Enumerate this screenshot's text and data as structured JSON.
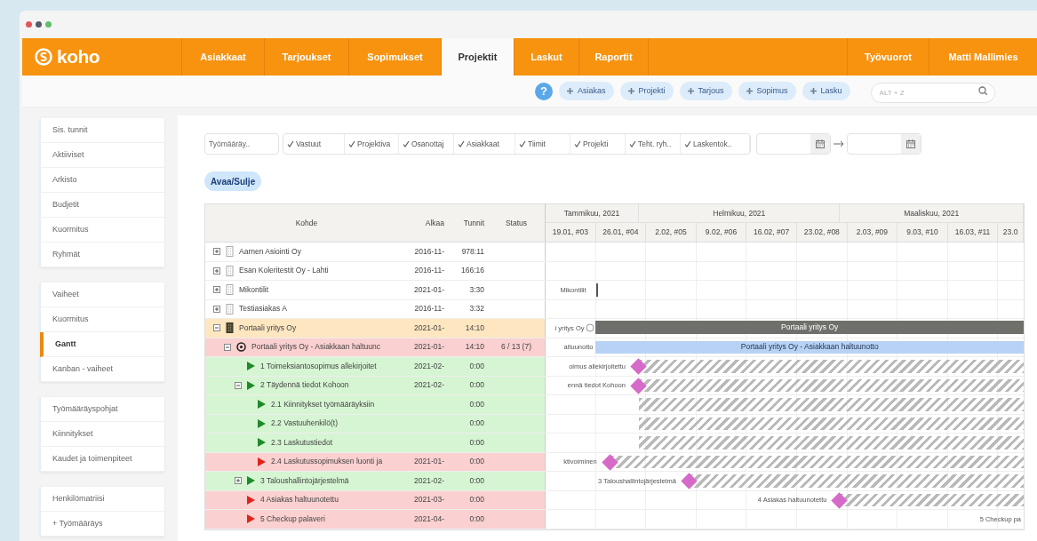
{
  "brand": "koho",
  "nav": [
    {
      "label": "Asiakkaat",
      "selected": false
    },
    {
      "label": "Tarjoukset",
      "selected": false
    },
    {
      "label": "Sopimukset",
      "selected": false
    },
    {
      "label": "Projektit",
      "selected": true
    },
    {
      "label": "Laskut",
      "selected": false
    },
    {
      "label": "Raportit",
      "selected": false
    }
  ],
  "nav_right": [
    "Työvuorot",
    "Matti Mallimies"
  ],
  "help": "?",
  "quick_add": [
    "Asiakas",
    "Projekti",
    "Tarjous",
    "Sopimus",
    "Lasku"
  ],
  "search": {
    "placeholder": "ALT + Z"
  },
  "sidebar": [
    {
      "items": [
        {
          "label": "Sis. tunnit",
          "selected": false
        },
        {
          "label": "Aktiiviset",
          "selected": false
        },
        {
          "label": "Arkisto",
          "selected": false
        },
        {
          "label": "Budjetit",
          "selected": false
        },
        {
          "label": "Kuormitus",
          "selected": false
        },
        {
          "label": "Ryhmät",
          "selected": false
        }
      ]
    },
    {
      "items": [
        {
          "label": "Vaiheet",
          "selected": false
        },
        {
          "label": "Kuormitus",
          "selected": false
        },
        {
          "label": "Gantt",
          "selected": true
        },
        {
          "label": "Kanban - vaiheet",
          "selected": false
        }
      ]
    },
    {
      "items": [
        {
          "label": "Työmääräyspohjat",
          "selected": false
        },
        {
          "label": "Kiinnitykset",
          "selected": false
        },
        {
          "label": "Kaudet ja toimenpiteet",
          "selected": false
        }
      ]
    },
    {
      "items": [
        {
          "label": "Henkilömatriisi",
          "selected": false
        },
        {
          "label": "+ Työmääräys",
          "selected": false
        }
      ]
    }
  ],
  "filters": {
    "dropdown": "Työmääräy..",
    "toggles": [
      {
        "label": "Vastuut",
        "checked": true
      },
      {
        "label": "Projektiva",
        "checked": true
      },
      {
        "label": "Osanottaj",
        "checked": true
      },
      {
        "label": "Asiakkaat",
        "checked": true
      },
      {
        "label": "Tiimit",
        "checked": true
      },
      {
        "label": "Projekti",
        "checked": true
      },
      {
        "label": "Teht. ryh..",
        "checked": true
      },
      {
        "label": "Laskentok..",
        "checked": true
      }
    ]
  },
  "toggle_button": "Avaa/Sulje",
  "table": {
    "columns": [
      "Kohde",
      "Alkaa",
      "Tunnit",
      "Status"
    ],
    "months": [
      "Tammikuu, 2021",
      "Helmikuu, 2021",
      "Maaliskuu, 2021"
    ],
    "weeks": [
      "19.01, #03",
      "26.01, #04",
      "2.02, #05",
      "9.02, #06",
      "16.02, #07",
      "23.02, #08",
      "2.03, #09",
      "9.03, #10",
      "16.03, #11",
      "23.0"
    ],
    "rows": [
      {
        "kind": "customer",
        "expanded": false,
        "color": "#ffffff",
        "name": "Aarnen Asiointi Oy",
        "start": "2016-11-",
        "hours": "978:11"
      },
      {
        "kind": "customer",
        "expanded": false,
        "color": "#ffffff",
        "name": "Esan Koleritestit Oy - Lahti",
        "start": "2016-11-",
        "hours": "166:16"
      },
      {
        "kind": "customer",
        "expanded": false,
        "color": "#ffffff",
        "name": "Mikontilit",
        "start": "2021-01-",
        "hours": "3:30",
        "gantt": {
          "label": "Mikontilit",
          "kind": "marker"
        }
      },
      {
        "kind": "customer",
        "expanded": false,
        "color": "#ffffff",
        "name": "Testiasiakas A",
        "start": "2016-11-",
        "hours": "3:32"
      },
      {
        "kind": "customer",
        "expanded": true,
        "color": "#fde6c0",
        "name": "Portaali yritys Oy",
        "start": "2021-01-",
        "hours": "14:10",
        "gantt": {
          "label": "i yritys Oy",
          "kind": "summary",
          "level": 0.895,
          "text": "Portaali yritys Oy"
        },
        "children": [
          {
            "kind": "project",
            "expanded": true,
            "color": "#fbd0d0",
            "name": "Portaali yritys Oy - Asiakkaan haltuunc",
            "start": "2021-01-",
            "hours": "14:10",
            "status": "6 / 13 (7)",
            "gantt": {
              "label": "altuunotto",
              "kind": "task",
              "level": 0.895,
              "text": "Portaali yritys Oy - Asiakkaan haltuunotto"
            },
            "children": [
              {
                "kind": "task",
                "late": false,
                "color": "#d6f5d3",
                "name": "1 Toimeksiantosopimus allekirjoitet",
                "start": "2021-02-",
                "hours": "0:00",
                "gantt": {
                  "label": "oimus allekirjoitettu",
                  "kind": "milestone",
                  "level": 0.805
                }
              },
              {
                "kind": "task",
                "late": false,
                "expanded": true,
                "color": "#d6f5d3",
                "name": "2 Täydennä tiedot Kohoon",
                "start": "2021-02-",
                "hours": "0:00",
                "gantt": {
                  "label": "ennä tiedot Kohoon",
                  "kind": "milestone",
                  "level": 0.805
                },
                "children": [
                  {
                    "kind": "task",
                    "late": false,
                    "color": "#d6f5d3",
                    "name": "2.1 Kiinnitykset työmääräyksiin",
                    "hours": "0:00",
                    "gantt": {
                      "kind": "hatch",
                      "level": 0.805
                    }
                  },
                  {
                    "kind": "task",
                    "late": false,
                    "color": "#d6f5d3",
                    "name": "2.2 Vastuuhenkilö(t)",
                    "hours": "0:00",
                    "gantt": {
                      "kind": "hatch",
                      "level": 0.805
                    }
                  },
                  {
                    "kind": "task",
                    "late": false,
                    "color": "#d6f5d3",
                    "name": "2.3 Laskutustiedot",
                    "hours": "0:00",
                    "gantt": {
                      "kind": "hatch",
                      "level": 0.805
                    }
                  },
                  {
                    "kind": "task",
                    "late": true,
                    "color": "#fbd0d0",
                    "name": "2.4 Laskutussopimuksen luonti ja",
                    "start": "2021-01-",
                    "hours": "0:00",
                    "gantt": {
                      "label": "ktivoiminen",
                      "kind": "milestone",
                      "level": 0.865
                    }
                  }
                ]
              },
              {
                "kind": "task",
                "late": false,
                "expanded": false,
                "color": "#d6f5d3",
                "name": "3 Taloushallintojärjestelmä",
                "start": "2021-02-",
                "hours": "0:00",
                "gantt": {
                  "label": "3 Taloushallintojärjestelmä",
                  "kind": "milestone",
                  "level": 0.699
                }
              },
              {
                "kind": "task",
                "late": true,
                "color": "#fbd0d0",
                "name": "4 Asiakas haltuunotettu",
                "start": "2021-03-",
                "hours": "0:00",
                "gantt": {
                  "label": "4 Asiakas haltuunotettu",
                  "kind": "milestone",
                  "level": 0.384
                }
              },
              {
                "kind": "task",
                "late": true,
                "color": "#fbd0d0",
                "name": "5 Checkup palaveri",
                "start": "2021-04-",
                "hours": "0:00",
                "gantt": {
                  "label": "5 Checkup pa"
                }
              }
            ]
          }
        ]
      }
    ]
  }
}
